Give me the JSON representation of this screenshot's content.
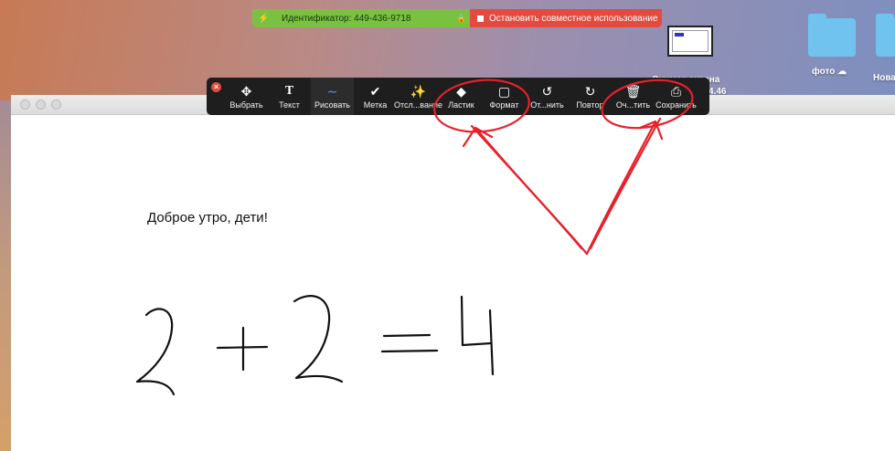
{
  "share_bar": {
    "meeting_id": "Идентификатор: 449-436-9718",
    "stop_label": "Остановить совместное использование"
  },
  "desktop": {
    "screenshot_label_line1": "Снимок экрана",
    "screenshot_label_line2": "4.46",
    "folder1_label": "фото",
    "folder2_label": "Нова"
  },
  "toolbar": {
    "tools": [
      {
        "label": "Выбрать",
        "icon": "move-icon"
      },
      {
        "label": "Текст",
        "icon": "text-icon"
      },
      {
        "label": "Рисовать",
        "icon": "draw-icon"
      },
      {
        "label": "Метка",
        "icon": "checkmark-icon"
      },
      {
        "label": "Отсл...вание",
        "icon": "spotlight-wand-icon"
      },
      {
        "label": "Ластик",
        "icon": "eraser-icon"
      },
      {
        "label": "Формат",
        "icon": "format-icon"
      },
      {
        "label": "От...нить",
        "icon": "undo-icon"
      },
      {
        "label": "Повтор",
        "icon": "redo-icon"
      },
      {
        "label": "Оч...тить",
        "icon": "trash-icon"
      },
      {
        "label": "Сохранить",
        "icon": "save-icon"
      }
    ],
    "active_tool": "Рисовать"
  },
  "document": {
    "greeting": "Доброе утро, дети!"
  },
  "colors": {
    "share_green": "#7ac142",
    "share_red": "#e44a3e",
    "toolbar_bg": "#1e1e1e",
    "annotation_red": "#e8202a",
    "active_tool_blue": "#4a9ff5"
  }
}
